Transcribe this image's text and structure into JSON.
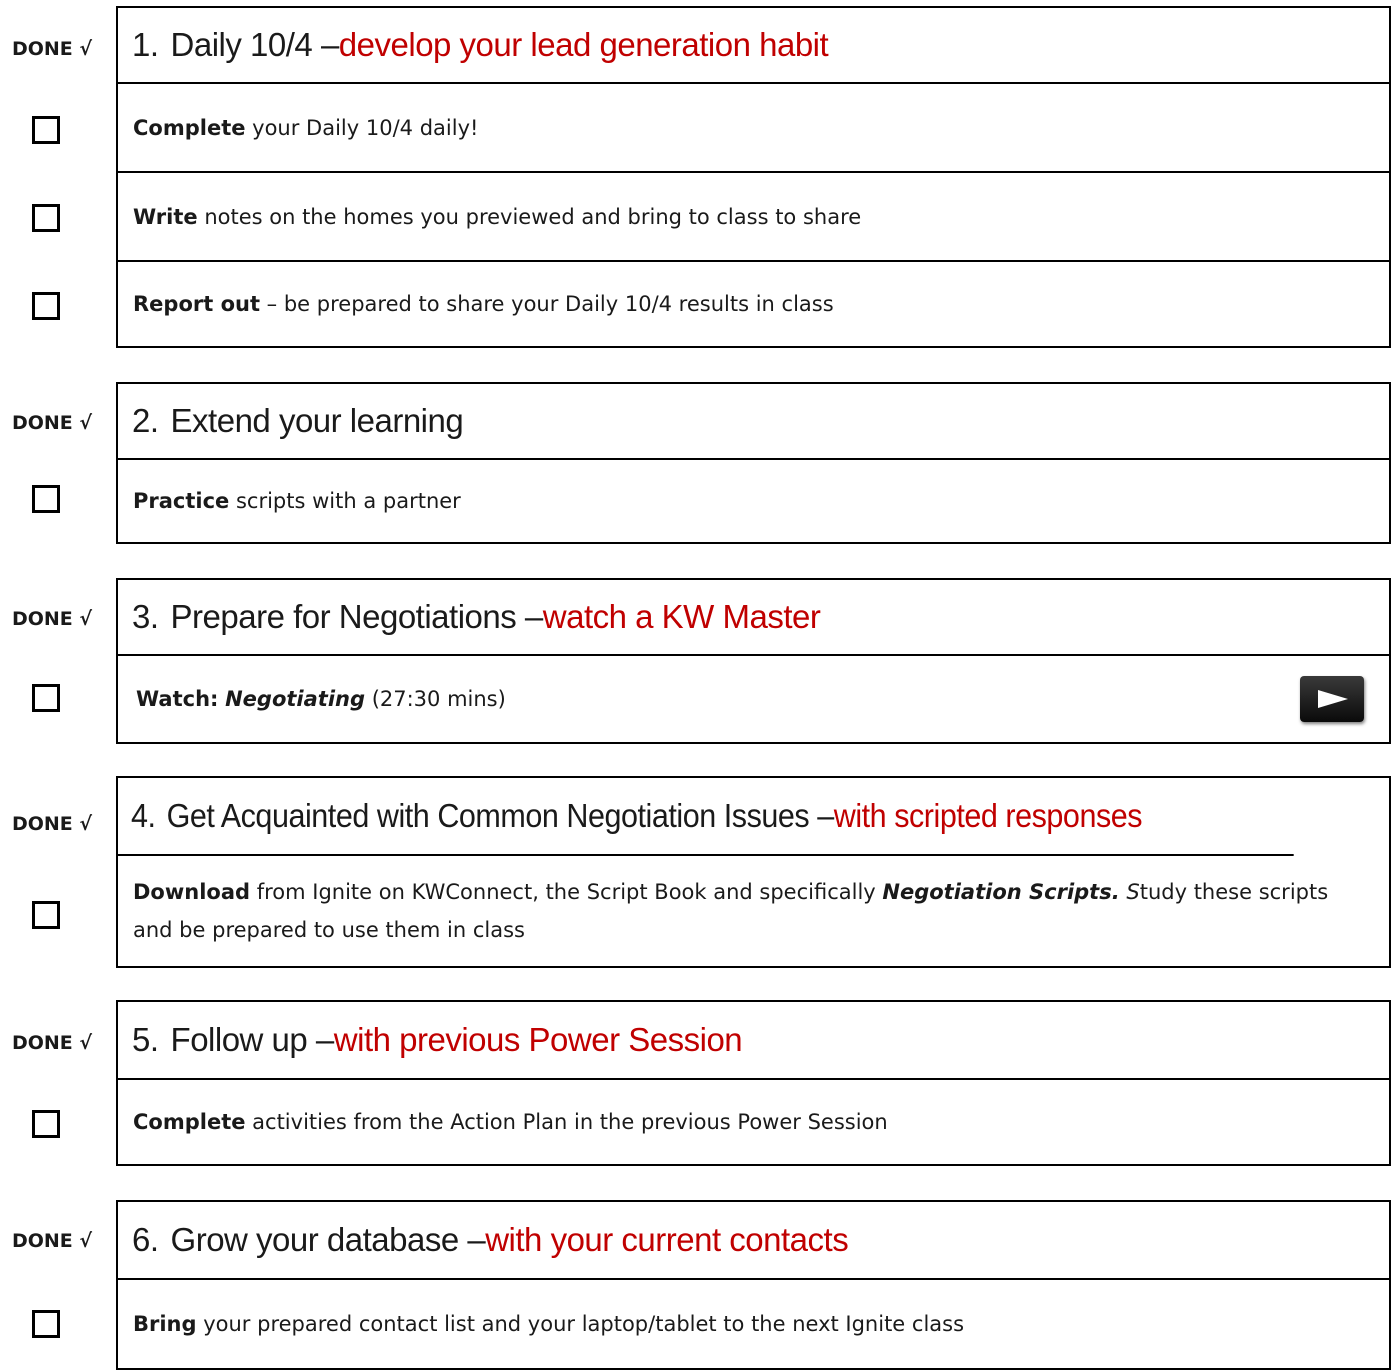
{
  "done_label": "DONE √",
  "sections": [
    {
      "num": "1.",
      "title": "Daily 10/4 – ",
      "subtitle": "develop your lead generation habit",
      "tasks": [
        {
          "bold": "Complete",
          "text": " your Daily 10/4 daily!"
        },
        {
          "bold": "Write",
          "text": " notes on the homes you previewed and bring to class to share"
        },
        {
          "bold": "Report out",
          "text": " – be prepared to share your Daily 10/4 results in class"
        }
      ]
    },
    {
      "num": "2.",
      "title": "Extend your learning",
      "subtitle": "",
      "tasks": [
        {
          "bold": "Practice",
          "text": " scripts with a partner"
        }
      ]
    },
    {
      "num": "3.",
      "title": "Prepare for Negotiations – ",
      "subtitle": "watch a KW Master",
      "tasks": [
        {
          "bold": "Watch:",
          "italic": "Negotiating",
          "text": " (27:30 mins)",
          "play_icon": "play-video-icon"
        }
      ]
    },
    {
      "num": "4.",
      "title": "Get Acquainted with Common Negotiation Issues – ",
      "subtitle": "with scripted responses",
      "tasks": [
        {
          "bold": "Download",
          "text_a": " from Ignite on KWConnect, the Script Book and specifically ",
          "italic_bold": "Negotiation Scripts.",
          "italic": " S",
          "text_b": "tudy these scripts and be prepared to use them in class"
        }
      ]
    },
    {
      "num": "5.",
      "title": "Follow up – ",
      "subtitle": "with previous Power Session",
      "tasks": [
        {
          "bold": "Complete",
          "text": " activities from the Action Plan in the previous Power Session"
        }
      ]
    },
    {
      "num": "6.",
      "title": "Grow your database – ",
      "subtitle": "with your current contacts",
      "tasks": [
        {
          "bold": "Bring",
          "text": " your prepared contact list and your laptop/tablet to the next Ignite class"
        }
      ]
    }
  ]
}
